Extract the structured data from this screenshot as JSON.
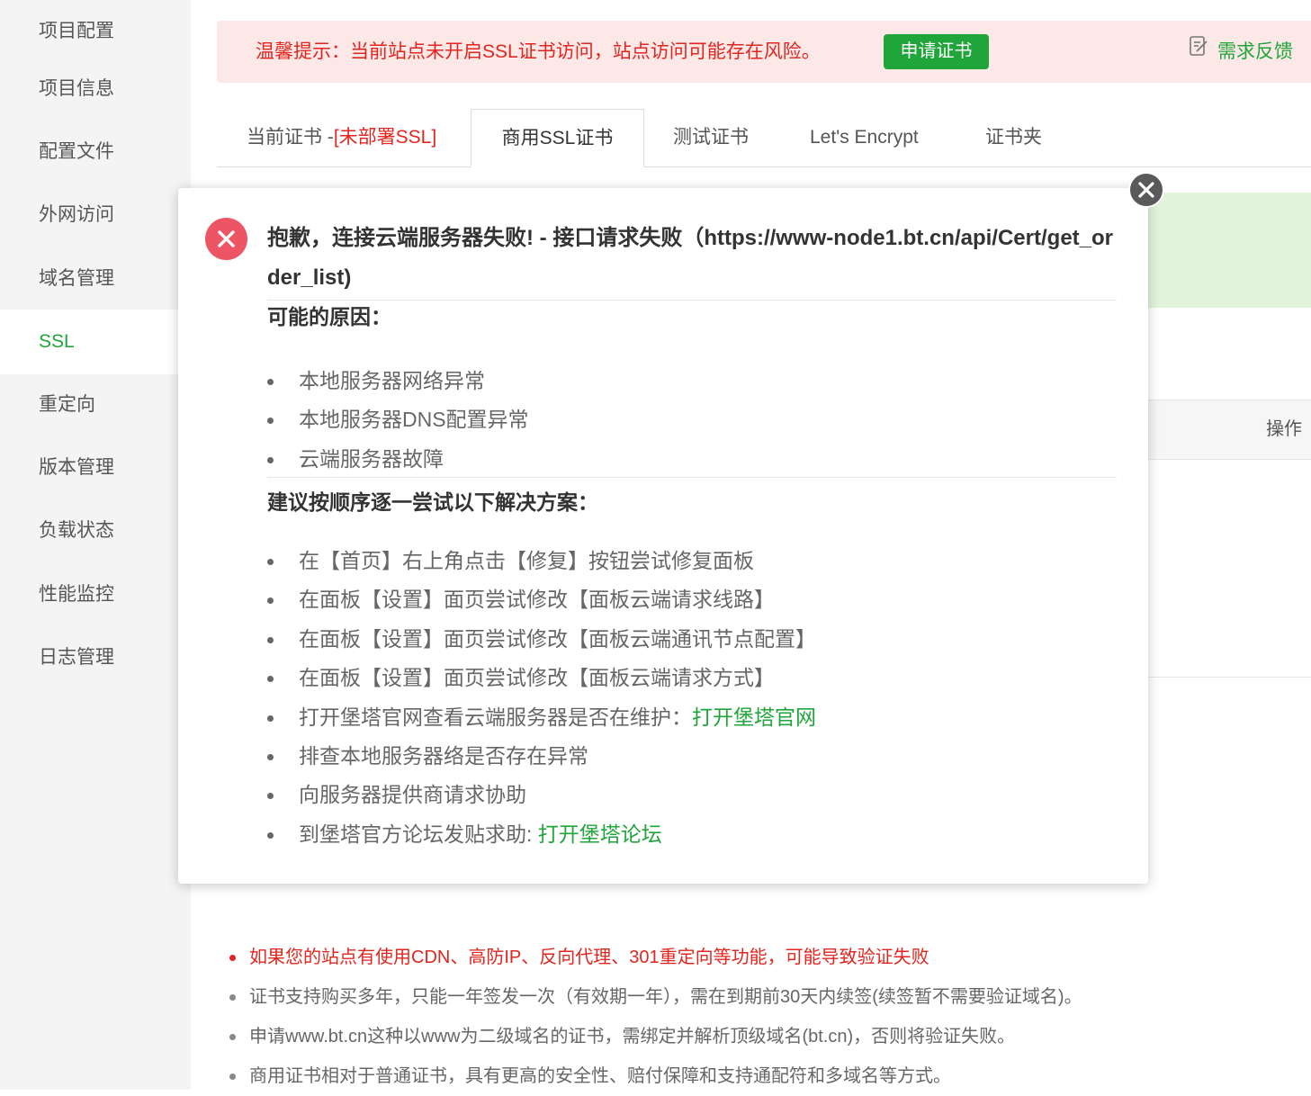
{
  "sidebar": {
    "items": [
      {
        "label": "项目配置"
      },
      {
        "label": "项目信息"
      },
      {
        "label": "配置文件"
      },
      {
        "label": "外网访问"
      },
      {
        "label": "域名管理"
      },
      {
        "label": "SSL"
      },
      {
        "label": "重定向"
      },
      {
        "label": "版本管理"
      },
      {
        "label": "负载状态"
      },
      {
        "label": "性能监控"
      },
      {
        "label": "日志管理"
      }
    ],
    "active": "SSL"
  },
  "warning": {
    "text": "温馨提示：当前站点未开启SSL证书访问，站点访问可能存在风险。",
    "apply_label": "申请证书",
    "feedback_label": "需求反馈"
  },
  "tabs": {
    "current_prefix": "当前证书 -",
    "current_status": "[未部署SSL]",
    "commercial": "商用SSL证书",
    "test": "测试证书",
    "letsencrypt": "Let's Encrypt",
    "folder": "证书夹"
  },
  "table": {
    "operation_header": "操作"
  },
  "notes": [
    "如果您的站点有使用CDN、高防IP、反向代理、301重定向等功能，可能导致验证失败",
    "证书支持购买多年，只能一年签发一次（有效期一年），需在到期前30天内续签(续签暂不需要验证域名)。",
    "申请www.bt.cn这种以www为二级域名的证书，需绑定并解析顶级域名(bt.cn)，否则将验证失败。",
    "商用证书相对于普通证书，具有更高的安全性、赔付保障和支持通配符和多域名等方式。"
  ],
  "dialog": {
    "title": "抱歉，连接云端服务器失败! - 接口请求失败（https://www-node1.bt.cn/api/Cert/get_order_list)",
    "reasons_title": "可能的原因：",
    "reasons": [
      "本地服务器网络异常",
      "本地服务器DNS配置异常",
      "云端服务器故障"
    ],
    "solutions_title": "建议按顺序逐一尝试以下解决方案：",
    "solutions": [
      "在【首页】右上角点击【修复】按钮尝试修复面板",
      "在面板【设置】面页尝试修改【面板云端请求线路】",
      "在面板【设置】面页尝试修改【面板云端通讯节点配置】",
      "在面板【设置】面页尝试修改【面板云端请求方式】"
    ],
    "official_site_text": "打开堡塔官网查看云端服务器是否在维护：",
    "official_site_link": "打开堡塔官网",
    "check_local": "排查本地服务器络是否存在异常",
    "ask_provider": "向服务器提供商请求协助",
    "forum_text": "到堡塔官方论坛发贴求助: ",
    "forum_link": "打开堡塔论坛"
  },
  "colors": {
    "accent": "#20a53a",
    "danger": "#e0261f",
    "error_icon": "#ed5565",
    "warning_bg": "#fde8e8"
  }
}
